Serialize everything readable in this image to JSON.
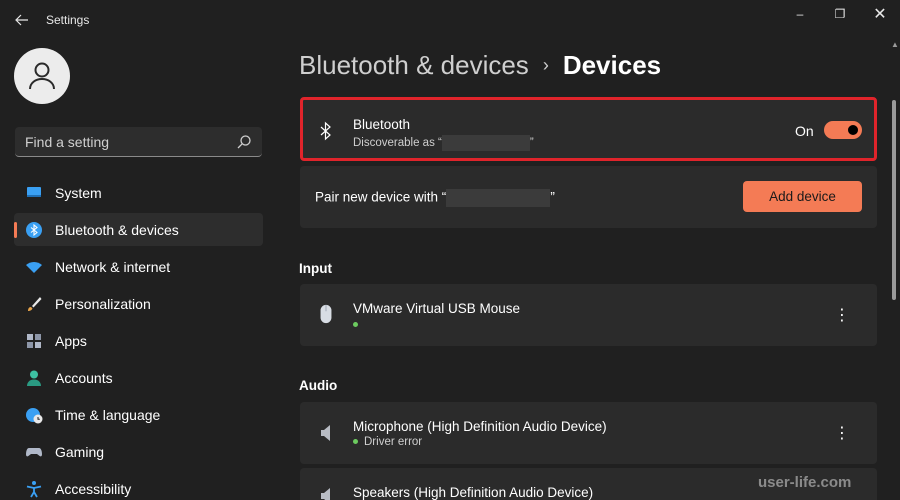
{
  "window": {
    "title": "Settings",
    "back_icon": "arrow-left-icon",
    "controls": {
      "minimize": "–",
      "maximize": "❐",
      "close": "✕"
    }
  },
  "search": {
    "placeholder": "Find a setting"
  },
  "sidebar": {
    "items": [
      {
        "label": "System",
        "icon": "system-icon",
        "color": "#3aa0f3",
        "active": false
      },
      {
        "label": "Bluetooth & devices",
        "icon": "bluetooth-icon",
        "color": "#3aa0f3",
        "active": true
      },
      {
        "label": "Network & internet",
        "icon": "wifi-icon",
        "color": "#3aa0f3",
        "active": false
      },
      {
        "label": "Personalization",
        "icon": "brush-icon",
        "color": "#e8a44a",
        "active": false
      },
      {
        "label": "Apps",
        "icon": "apps-icon",
        "color": "#b0b8c8",
        "active": false
      },
      {
        "label": "Accounts",
        "icon": "accounts-icon",
        "color": "#3dc1a3",
        "active": false
      },
      {
        "label": "Time & language",
        "icon": "globe-clock-icon",
        "color": "#3aa0f3",
        "active": false
      },
      {
        "label": "Gaming",
        "icon": "gamepad-icon",
        "color": "#b0b8c8",
        "active": false
      },
      {
        "label": "Accessibility",
        "icon": "accessibility-icon",
        "color": "#3aa0f3",
        "active": false
      }
    ]
  },
  "breadcrumb": {
    "parent": "Bluetooth & devices",
    "separator": "›",
    "current": "Devices"
  },
  "bluetooth": {
    "title": "Bluetooth",
    "subtitle_prefix": "Discoverable as “",
    "subtitle_suffix": "”",
    "toggle_label": "On",
    "toggle_on": true
  },
  "pair": {
    "prefix": "Pair new device with “",
    "suffix": "”",
    "button": "Add device"
  },
  "sections": {
    "input": "Input",
    "audio": "Audio"
  },
  "devices": {
    "mouse": {
      "name": "VMware Virtual USB Mouse",
      "status": ""
    },
    "microphone": {
      "name": "Microphone (High Definition Audio Device)",
      "status": "Driver error"
    },
    "speakers": {
      "name": "Speakers (High Definition Audio Device)"
    }
  },
  "more_glyph": "⋮",
  "watermark": "user-life.com",
  "colors": {
    "accent": "#f47b55",
    "highlight_border": "#e0242b",
    "status_ok": "#6ccb5f"
  }
}
